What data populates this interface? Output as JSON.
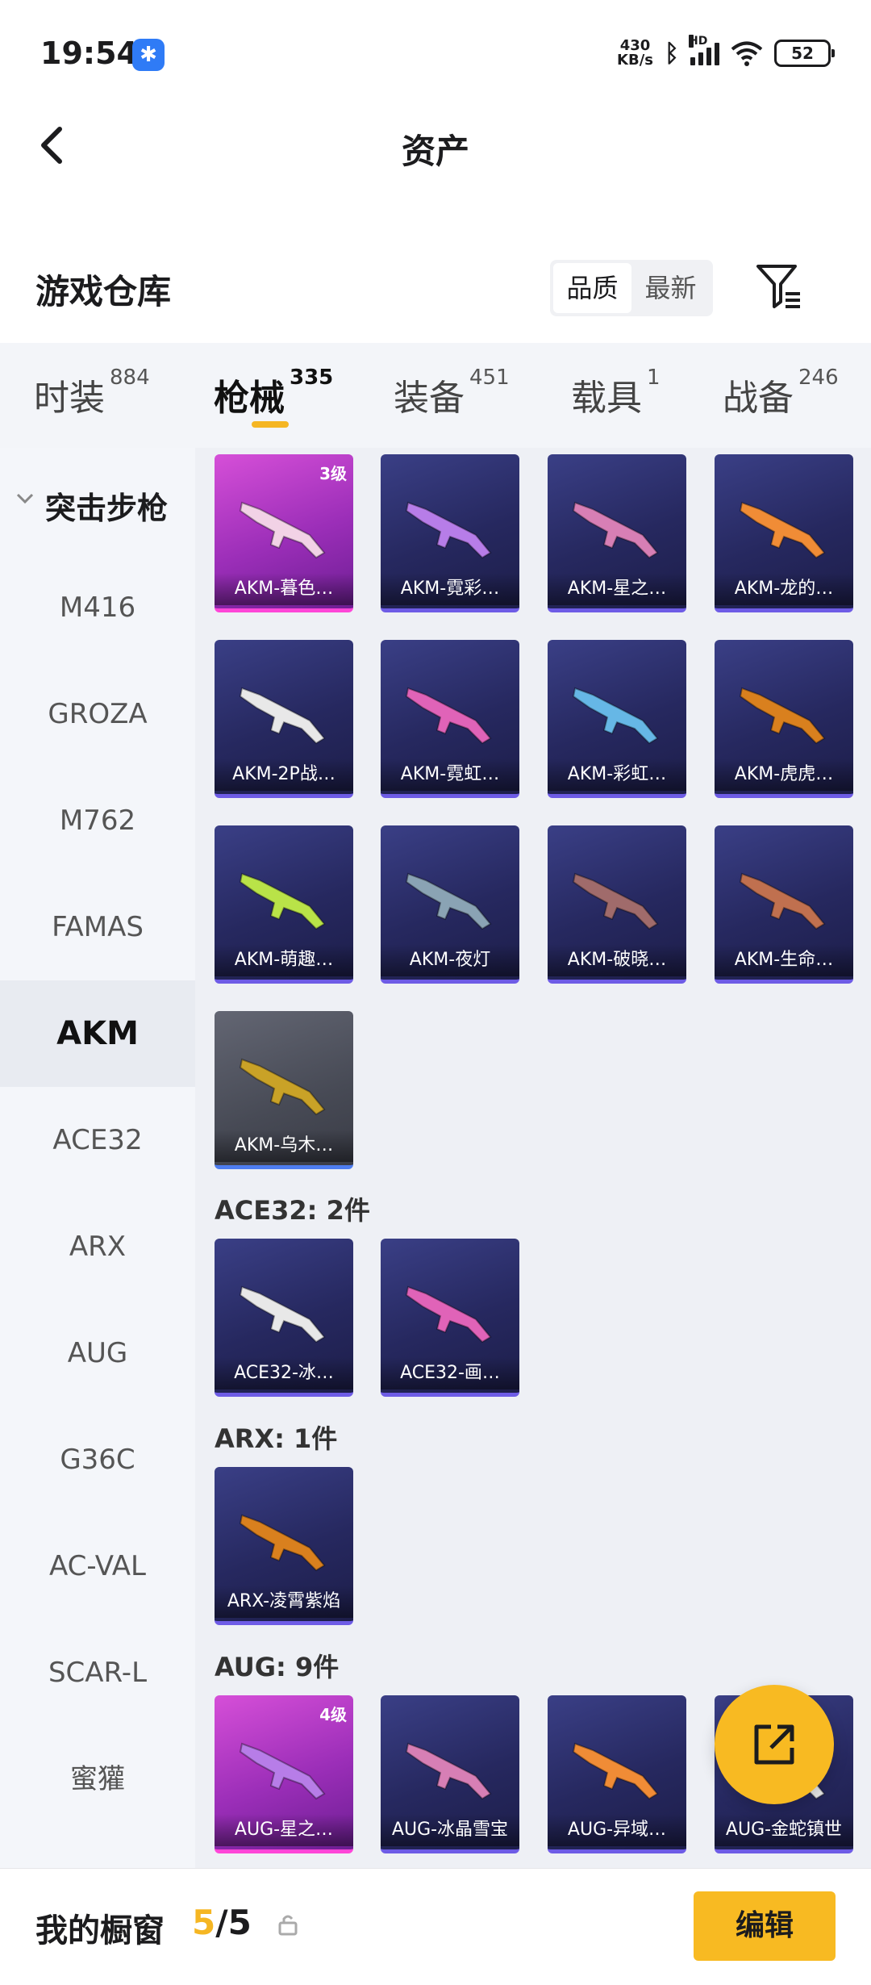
{
  "status": {
    "time": "19:54",
    "net_speed_value": "430",
    "net_speed_unit": "KB/s",
    "hd_label": "HD",
    "battery": "52"
  },
  "nav": {
    "title": "资产"
  },
  "warehouse": {
    "title": "游戏仓库",
    "sort_options": [
      "品质",
      "最新"
    ],
    "active_sort": "品质"
  },
  "tabs": [
    {
      "label": "时装",
      "count": "884"
    },
    {
      "label": "枪械",
      "count": "335",
      "active": true
    },
    {
      "label": "装备",
      "count": "451"
    },
    {
      "label": "载具",
      "count": "1"
    },
    {
      "label": "战备",
      "count": "246"
    }
  ],
  "sidebar": {
    "group": "突击步枪",
    "items": [
      "M416",
      "GROZA",
      "M762",
      "FAMAS",
      "AKM",
      "ACE32",
      "ARX",
      "AUG",
      "G36C",
      "AC-VAL",
      "SCAR-L",
      "蜜獾"
    ],
    "active": "AKM"
  },
  "akm_cards": [
    {
      "name": "AKM-暮色…",
      "level": "3级",
      "rarity": "pink"
    },
    {
      "name": "AKM-霓彩…",
      "rarity": "purple"
    },
    {
      "name": "AKM-星之…",
      "rarity": "purple"
    },
    {
      "name": "AKM-龙的…",
      "rarity": "purple"
    },
    {
      "name": "AKM-2P战…",
      "rarity": "purple"
    },
    {
      "name": "AKM-霓虹…",
      "rarity": "purple"
    },
    {
      "name": "AKM-彩虹…",
      "rarity": "purple"
    },
    {
      "name": "AKM-虎虎…",
      "rarity": "purple"
    },
    {
      "name": "AKM-萌趣…",
      "rarity": "purple"
    },
    {
      "name": "AKM-夜灯",
      "rarity": "purple"
    },
    {
      "name": "AKM-破晓…",
      "rarity": "purple"
    },
    {
      "name": "AKM-生命…",
      "rarity": "purple"
    },
    {
      "name": "AKM-乌木…",
      "rarity": "gray"
    }
  ],
  "ace32_group": {
    "label": "ACE32: 2件",
    "cards": [
      {
        "name": "ACE32-冰…",
        "rarity": "purple"
      },
      {
        "name": "ACE32-画…",
        "rarity": "purple"
      }
    ]
  },
  "arx_group": {
    "label": "ARX: 1件",
    "cards": [
      {
        "name": "ARX-凌霄紫焰",
        "rarity": "purple"
      }
    ]
  },
  "aug_group": {
    "label": "AUG: 9件",
    "cards": [
      {
        "name": "AUG-星之…",
        "level": "4级",
        "rarity": "pink"
      },
      {
        "name": "AUG-冰晶雪宝",
        "rarity": "purple"
      },
      {
        "name": "AUG-异域…",
        "rarity": "purple"
      },
      {
        "name": "AUG-金蛇镇世",
        "rarity": "purple"
      }
    ]
  },
  "bottom": {
    "title": "我的橱窗",
    "current": "5",
    "separator": "/",
    "total": "5",
    "edit_label": "编辑"
  },
  "colors": {
    "accent": "#f8ba22",
    "purple_card": "#2b2d6a",
    "pink_card": "#b83ccf"
  }
}
